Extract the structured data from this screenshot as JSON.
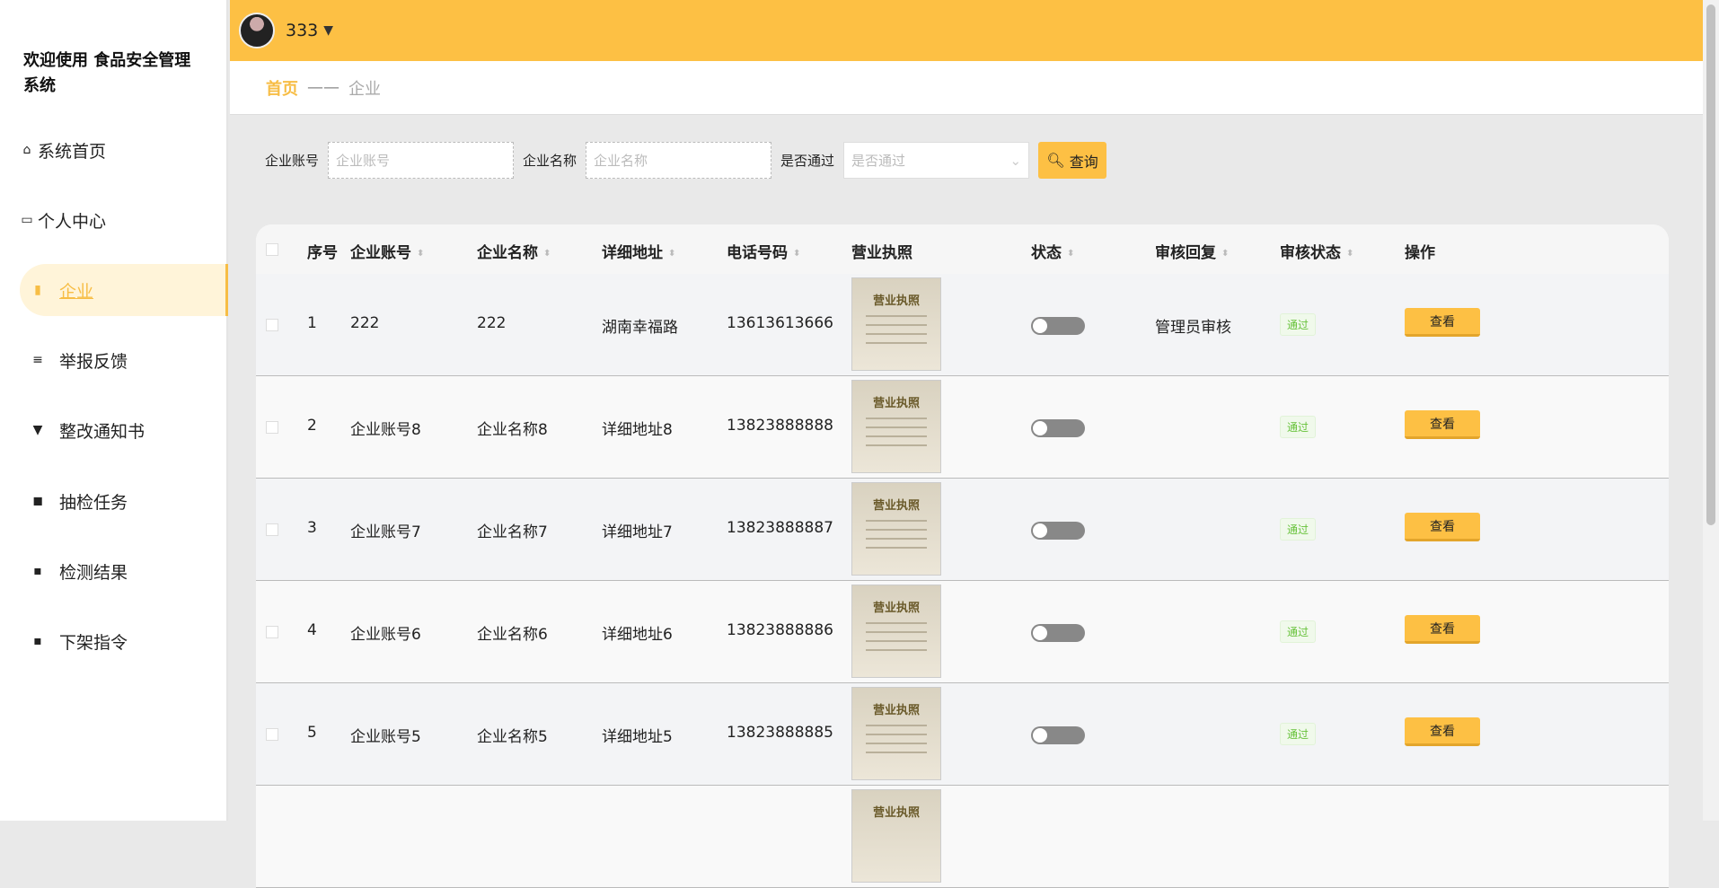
{
  "sidebar": {
    "title": "欢迎使用 食品安全管理系统",
    "items": [
      {
        "label": "系统首页",
        "icon": "home-icon"
      },
      {
        "label": "个人中心",
        "icon": "card-icon"
      },
      {
        "label": "企业",
        "icon": "bar-chart-icon",
        "active": true
      },
      {
        "label": "举报反馈",
        "icon": "list-icon"
      },
      {
        "label": "整改通知书",
        "icon": "brush-icon"
      },
      {
        "label": "抽检任务",
        "icon": "wallet-icon"
      },
      {
        "label": "检测结果",
        "icon": "grid-icon"
      },
      {
        "label": "下架指令",
        "icon": "grid-icon"
      }
    ]
  },
  "header": {
    "username": "333"
  },
  "breadcrumb": {
    "home": "首页",
    "separator": "——",
    "current": "企业"
  },
  "search": {
    "account_label": "企业账号",
    "account_placeholder": "企业账号",
    "name_label": "企业名称",
    "name_placeholder": "企业名称",
    "pass_label": "是否通过",
    "pass_placeholder": "是否通过",
    "query_label": "查询"
  },
  "table": {
    "columns": [
      "序号",
      "企业账号",
      "企业名称",
      "详细地址",
      "电话号码",
      "营业执照",
      "状态",
      "审核回复",
      "审核状态",
      "操作"
    ],
    "license_text": "营业执照",
    "rows": [
      {
        "seq": "1",
        "account": "222",
        "name": "222",
        "address": "湖南幸福路",
        "phone": "13613613666",
        "reply": "管理员审核",
        "audit": "通过",
        "action": "查看"
      },
      {
        "seq": "2",
        "account": "企业账号8",
        "name": "企业名称8",
        "address": "详细地址8",
        "phone": "13823888888",
        "reply": "",
        "audit": "通过",
        "action": "查看"
      },
      {
        "seq": "3",
        "account": "企业账号7",
        "name": "企业名称7",
        "address": "详细地址7",
        "phone": "13823888887",
        "reply": "",
        "audit": "通过",
        "action": "查看"
      },
      {
        "seq": "4",
        "account": "企业账号6",
        "name": "企业名称6",
        "address": "详细地址6",
        "phone": "13823888886",
        "reply": "",
        "audit": "通过",
        "action": "查看"
      },
      {
        "seq": "5",
        "account": "企业账号5",
        "name": "企业名称5",
        "address": "详细地址5",
        "phone": "13823888885",
        "reply": "",
        "audit": "通过",
        "action": "查看"
      }
    ]
  }
}
